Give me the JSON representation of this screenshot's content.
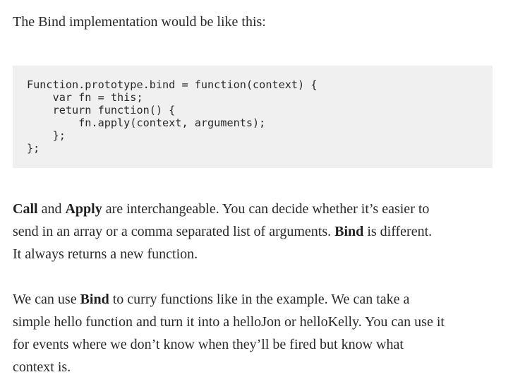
{
  "intro": "The Bind implementation would be like this:",
  "code": [
    "Function.prototype.bind = function(context) {",
    "    var fn = this;",
    "    return function() {",
    "        fn.apply(context, arguments);",
    "    };",
    "};"
  ],
  "p1": {
    "l1_b1": "Call",
    "l1_t1": " and ",
    "l1_b2": "Apply",
    "l1_t2": " are interchangeable. You can decide whether it’s easier to",
    "l2_t1": "send in an array or a comma separated list of arguments. ",
    "l2_b1": "Bind",
    "l2_t2": " is different.",
    "l3_t1": "It always returns a new function."
  },
  "p2": {
    "l1_t1": "We can use ",
    "l1_b1": "Bind",
    "l1_t2": " to curry functions like in the example. We can take a",
    "l2_t1": "simple hello function and turn it into a helloJon or helloKelly. You can use it",
    "l3_t1": "for events where we don’t know when they’ll be fired but know what",
    "l4_t1": "context is."
  }
}
